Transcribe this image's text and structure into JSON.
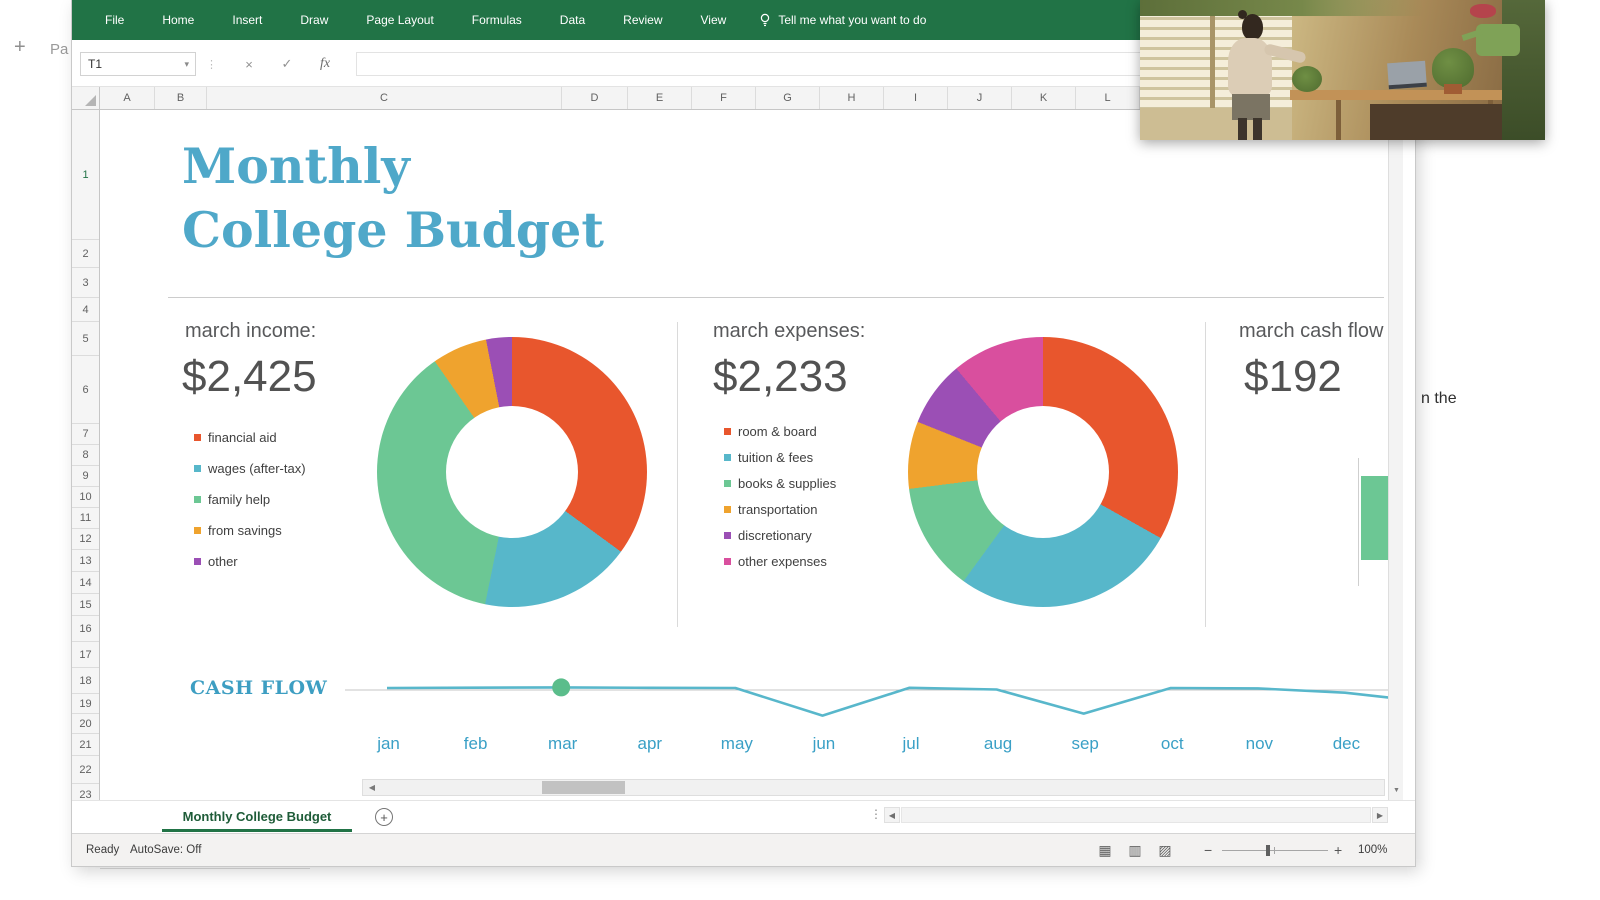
{
  "background": {
    "plus": "+",
    "partial_left_text": "Pa",
    "partial_right_text": "n the"
  },
  "ribbon": {
    "tabs": [
      "File",
      "Home",
      "Insert",
      "Draw",
      "Page Layout",
      "Formulas",
      "Data",
      "Review",
      "View"
    ],
    "tell_me": "Tell me what you want to do"
  },
  "formula_bar": {
    "name_box_value": "T1",
    "fx_label": "fx"
  },
  "grid": {
    "column_headers": [
      "A",
      "B",
      "C",
      "D",
      "E",
      "F",
      "G",
      "H",
      "I",
      "J",
      "K",
      "L"
    ],
    "row_headers": [
      "1",
      "2",
      "3",
      "4",
      "5",
      "6",
      "7",
      "8",
      "9",
      "10",
      "11",
      "12",
      "13",
      "14",
      "15",
      "16",
      "17",
      "18",
      "19",
      "20",
      "21",
      "22",
      "23"
    ]
  },
  "sheet": {
    "title_line1": "Monthly",
    "title_line2": "College Budget",
    "income_panel": {
      "label": "march income:",
      "amount": "$2,425"
    },
    "expenses_panel": {
      "label": "march expenses:",
      "amount": "$2,233"
    },
    "cashflow_panel": {
      "label": "march cash flow",
      "amount": "$192"
    },
    "cashflow_chart_label": "CASH FLOW"
  },
  "chart_data": [
    {
      "type": "pie",
      "subtype": "donut",
      "title": "march income: $2,425",
      "total_label": "$2,425",
      "segments": [
        {
          "label": "financial aid",
          "value": 850,
          "color": "#e8562d"
        },
        {
          "label": "wages (after-tax)",
          "value": 440,
          "color": "#57b7ca"
        },
        {
          "label": "family help",
          "value": 900,
          "color": "#6cc794"
        },
        {
          "label": "from savings",
          "value": 160,
          "color": "#efa32e"
        },
        {
          "label": "other",
          "value": 75,
          "color": "#9b4fb5"
        }
      ]
    },
    {
      "type": "pie",
      "subtype": "donut",
      "title": "march expenses: $2,233",
      "total_label": "$2,233",
      "segments": [
        {
          "label": "room & board",
          "value": 740,
          "color": "#e8562d"
        },
        {
          "label": "tuition & fees",
          "value": 600,
          "color": "#57b7ca"
        },
        {
          "label": "books & supplies",
          "value": 290,
          "color": "#6cc794"
        },
        {
          "label": "transportation",
          "value": 180,
          "color": "#efa32e"
        },
        {
          "label": "discretionary",
          "value": 175,
          "color": "#9b4fb5"
        },
        {
          "label": "other expenses",
          "value": 248,
          "color": "#d94f9e"
        }
      ]
    },
    {
      "type": "line",
      "title": "CASH FLOW",
      "x": [
        "jan",
        "feb",
        "mar",
        "apr",
        "may",
        "jun",
        "jul",
        "aug",
        "sep",
        "oct",
        "nov",
        "dec"
      ],
      "values": [
        150,
        170,
        192,
        160,
        150,
        -1900,
        160,
        40,
        -1750,
        150,
        120,
        -200
      ],
      "highlight_point": {
        "x": "mar",
        "value": 192
      },
      "ylim": [
        -2600,
        2600
      ],
      "axis_line_at": 0,
      "line_color": "#58b7cb",
      "marker_color": "#5bbd8b",
      "axis_color": "#c4c4c4",
      "legend_position": "none",
      "grid": false
    }
  ],
  "sheet_tabs": {
    "active_tab": "Monthly College Budget"
  },
  "status_bar": {
    "mode": "Ready",
    "autosave": "AutoSave: Off",
    "zoom": "100%"
  },
  "icons": {
    "dropdown_caret": "▾",
    "close_x": "×",
    "check": "✓",
    "left_arrow": "◀",
    "right_arrow": "▶",
    "up_arrow": "▲",
    "down_arrow": "▼",
    "dots": "⋮",
    "view_normal": "▦",
    "view_layout": "▥",
    "view_break": "▨",
    "minus": "−",
    "plus": "+"
  }
}
